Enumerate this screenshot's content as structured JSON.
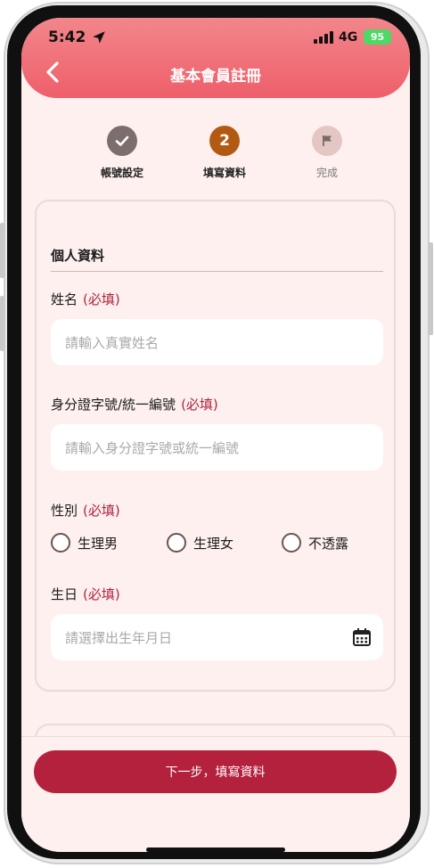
{
  "status_bar": {
    "time": "5:42",
    "network": "4G",
    "battery": "95"
  },
  "header": {
    "title": "基本會員註冊"
  },
  "steps": [
    {
      "label": "帳號設定",
      "state": "done"
    },
    {
      "number": "2",
      "label": "填寫資料",
      "state": "current"
    },
    {
      "label": "完成",
      "state": "upcoming"
    }
  ],
  "section": {
    "title": "個人資料"
  },
  "fields": {
    "name": {
      "label": "姓名",
      "required": "(必填)",
      "placeholder": "請輸入真實姓名"
    },
    "id": {
      "label": "身分證字號/統一編號",
      "required": "(必填)",
      "placeholder": "請輸入身分證字號或統一編號"
    },
    "gender": {
      "label": "性別",
      "required": "(必填)",
      "options": [
        "生理男",
        "生理女",
        "不透露"
      ]
    },
    "birthday": {
      "label": "生日",
      "required": "(必填)",
      "placeholder": "請選擇出生年月日"
    }
  },
  "footer": {
    "next_label": "下一步，填寫資料"
  },
  "colors": {
    "header_top": "#f2868b",
    "header_bottom": "#ee5f6a",
    "accent": "#b3213d",
    "step_done": "#7d6e6e",
    "step_current": "#b35a12",
    "step_upcoming": "#e4c7c4"
  },
  "icons": [
    "location-arrow-icon",
    "signal-icon",
    "battery-icon",
    "back-chevron-icon",
    "check-icon",
    "flag-icon",
    "calendar-icon"
  ]
}
